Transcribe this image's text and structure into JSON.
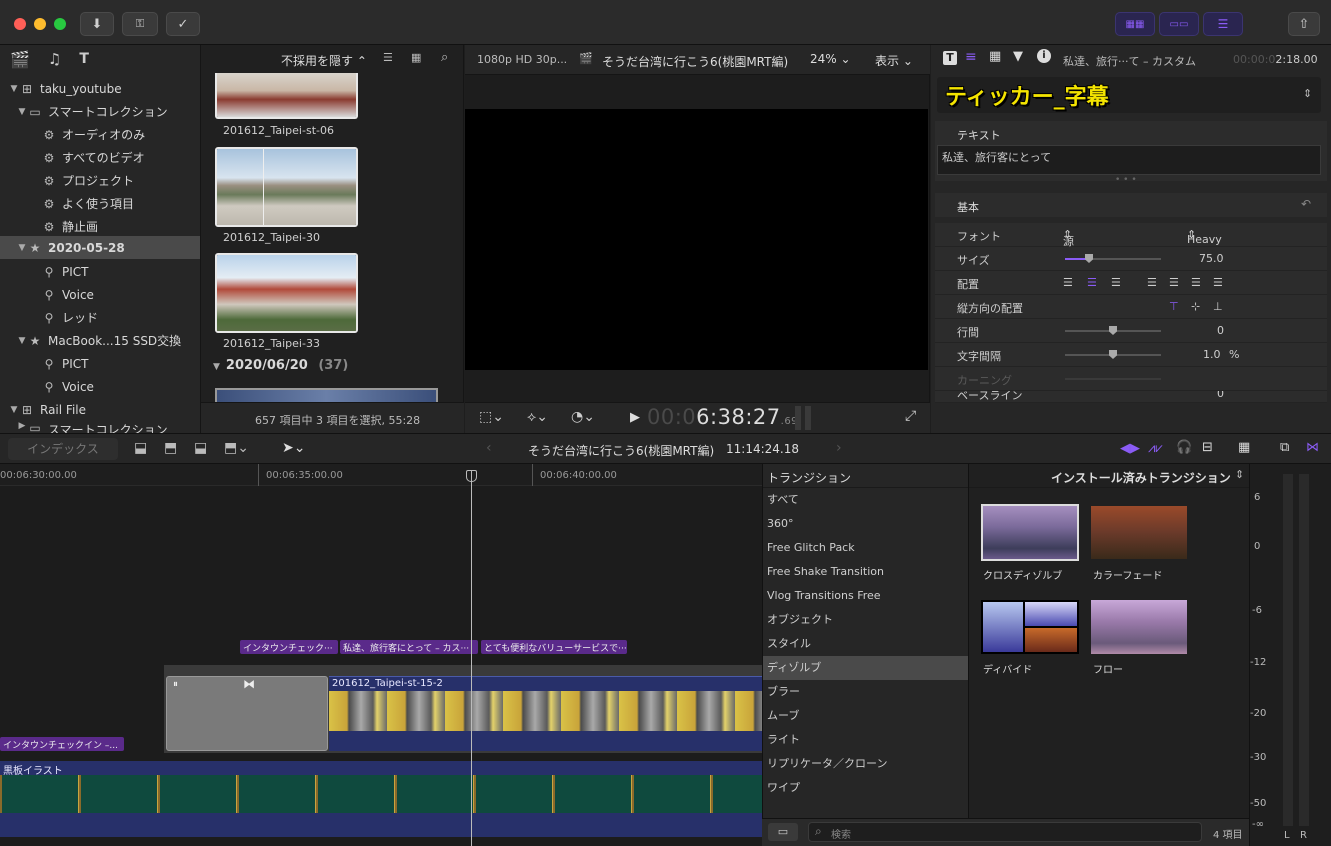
{
  "toolbar": {
    "download_icon": "download-icon",
    "key_icon": "key-icon",
    "check_icon": "checkmark-circle-icon",
    "share_icon": "share-icon"
  },
  "library": {
    "filter_label": "不採用を隠す",
    "items": [
      {
        "label": "taku_youtube"
      },
      {
        "label": "スマートコレクション"
      },
      {
        "label": "オーディオのみ"
      },
      {
        "label": "すべてのビデオ"
      },
      {
        "label": "プロジェクト"
      },
      {
        "label": "よく使う項目"
      },
      {
        "label": "静止画"
      },
      {
        "label": "2020-05-28"
      },
      {
        "label": "PICT"
      },
      {
        "label": "Voice"
      },
      {
        "label": "レッド"
      },
      {
        "label": "MacBook...15 SSD交換"
      },
      {
        "label": "PICT"
      },
      {
        "label": "Voice"
      },
      {
        "label": "Rail File"
      },
      {
        "label": "スマートコレクション"
      }
    ]
  },
  "browser": {
    "clips": [
      {
        "label": "201612_Taipei-st-06"
      },
      {
        "label": "201612_Taipei-30"
      },
      {
        "label": "201612_Taipei-33"
      }
    ],
    "date_header": "2020/06/20",
    "date_count": "(37)",
    "status": "657 項目中 3 項目を選択, 55:28"
  },
  "viewer": {
    "format": "1080p HD 30p...",
    "project_title": "そうだ台湾に行こう6(桃園MRT編)",
    "zoom": "24%",
    "display_menu": "表示",
    "timecode_dim": "00:0",
    "timecode": "6:38:27",
    "timecode_frames": ".69"
  },
  "inspector": {
    "header_title": "私達、旅行···て – カスタム",
    "header_timecode_dim": "00:00:0",
    "header_timecode": "2:18.00",
    "preset": "ティッカー_字幕",
    "text_section": "テキスト",
    "text_value": "私達、旅行客にとって",
    "basic_section": "基本",
    "font_label": "フォント",
    "font_value": "源ノ角ゴシック...",
    "weight_value": "Heavy",
    "size_label": "サイズ",
    "size_value": "75.0",
    "align_label": "配置",
    "valign_label": "縦方向の配置",
    "line_label": "行間",
    "line_value": "0",
    "tracking_label": "文字間隔",
    "tracking_value": "1.0",
    "tracking_unit": "%",
    "kerning_label": "カーニング",
    "baseline_label": "ベースライン",
    "baseline_value": "0"
  },
  "timeline_toolbar": {
    "index": "インデックス",
    "project": "そうだ台湾に行こう6(桃園MRT編)",
    "duration": "11:14:24.18"
  },
  "timeline": {
    "ruler": [
      "00:06:30:00.00",
      "00:06:35:00.00",
      "00:06:40:00.00"
    ],
    "titles": [
      "インタウンチェック···",
      "私達、旅行客にとって – カス···",
      "とても便利なバリューサービスで···"
    ],
    "main_clip": "201612_Taipei-st-15-2",
    "left_title": "インタウンチェックイン –...",
    "board_clip": "黒板イラスト"
  },
  "transitions": {
    "header": "トランジション",
    "installed": "インストール済みトランジション",
    "categories": [
      "すべて",
      "360°",
      "Free Glitch Pack",
      "Free Shake Transition",
      "Vlog Transitions Free",
      "オブジェクト",
      "スタイル",
      "ディゾルブ",
      "ブラー",
      "ムーブ",
      "ライト",
      "リプリケータ／クローン",
      "ワイプ"
    ],
    "selected_index": 7,
    "items": [
      {
        "label": "クロスディゾルブ"
      },
      {
        "label": "カラーフェード"
      },
      {
        "label": "ディバイド"
      },
      {
        "label": "フロー"
      }
    ],
    "search_placeholder": "検索",
    "count": "4 項目"
  },
  "meters": {
    "scale": [
      "6",
      "0",
      "-6",
      "-12",
      "-20",
      "-30",
      "-50",
      "-∞"
    ],
    "left": "L",
    "right": "R"
  }
}
